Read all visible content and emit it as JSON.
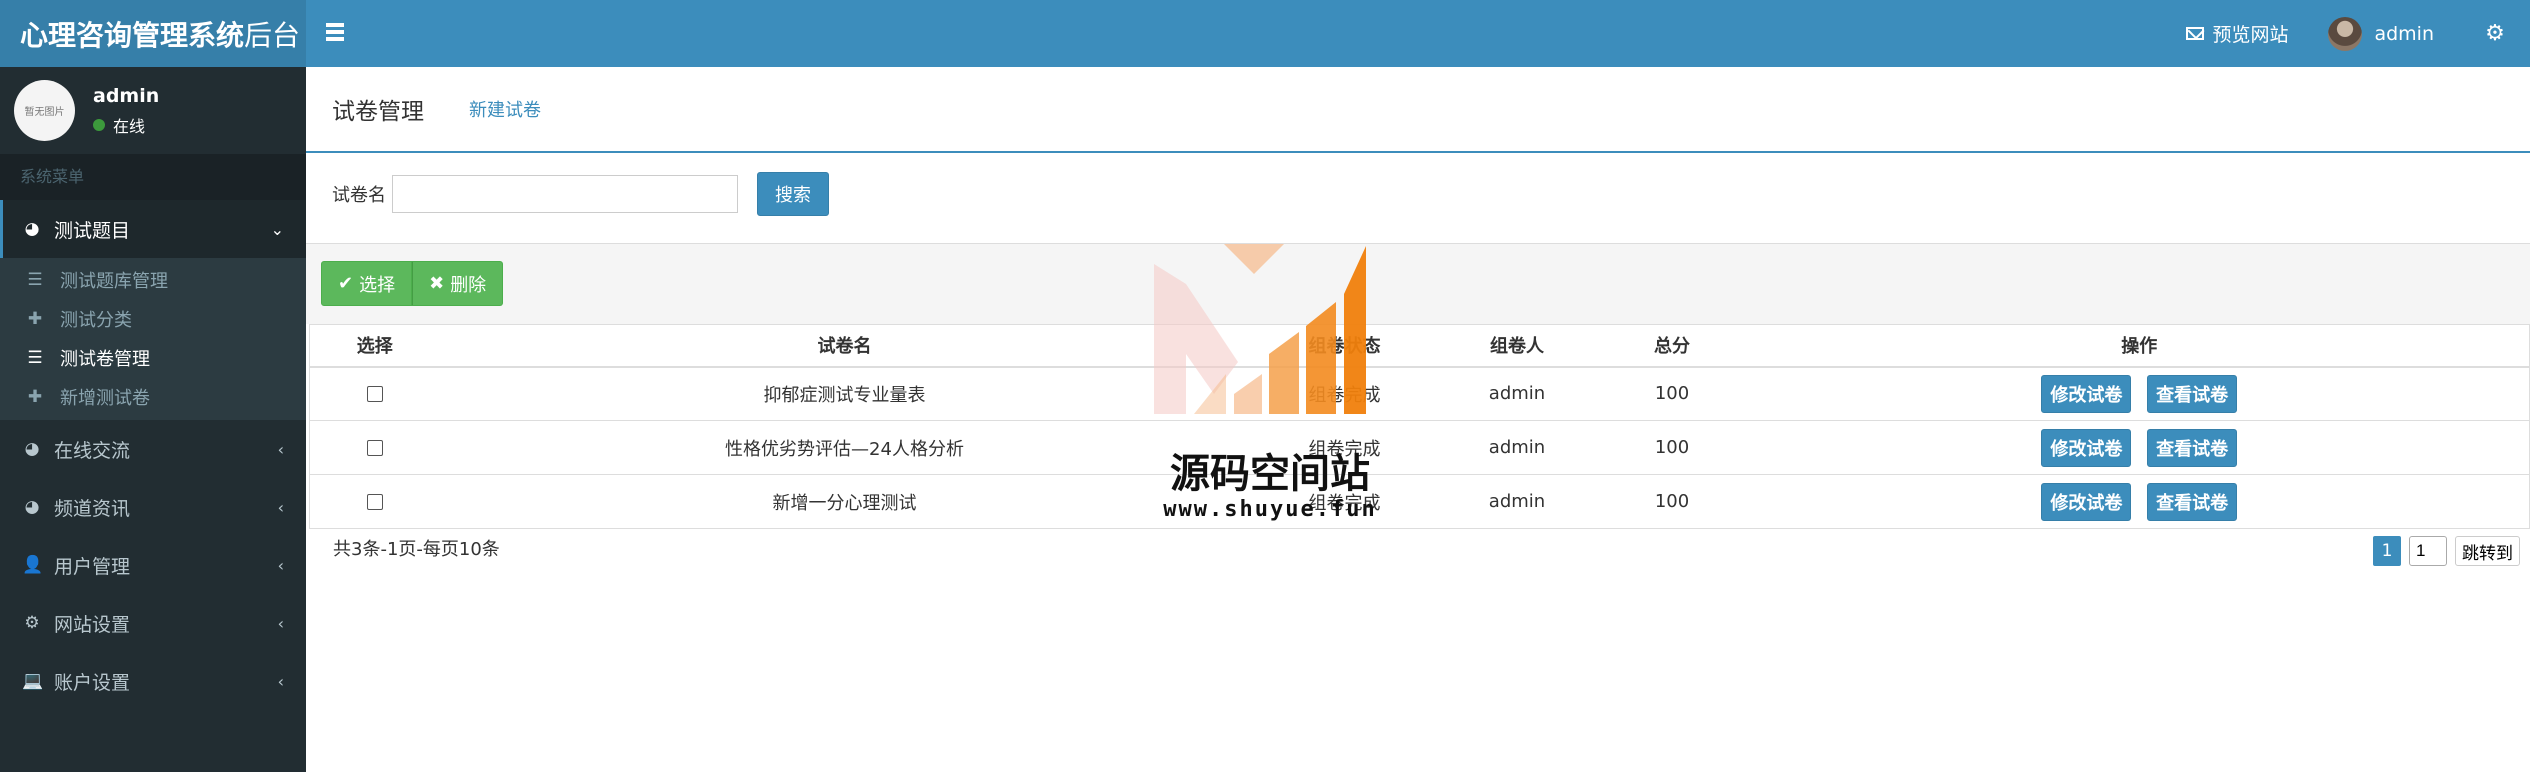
{
  "app": {
    "title_bold": "心理咨询管理系统",
    "title_light": "后台"
  },
  "topbar": {
    "preview_label": "预览网站",
    "username": "admin"
  },
  "sidebar": {
    "user": {
      "avatar_text": "暂无图片",
      "name": "admin",
      "status": "在线"
    },
    "menu_header": "系统菜单",
    "menu": [
      {
        "label": "测试题目",
        "icon": "pie-chart-icon",
        "expanded": true,
        "children": [
          {
            "label": "测试题库管理",
            "icon": "list-icon"
          },
          {
            "label": "测试分类",
            "icon": "plus-icon"
          },
          {
            "label": "测试卷管理",
            "icon": "list-icon",
            "active": true
          },
          {
            "label": "新增测试卷",
            "icon": "plus-icon"
          }
        ]
      },
      {
        "label": "在线交流",
        "icon": "pie-chart-icon"
      },
      {
        "label": "频道资讯",
        "icon": "pie-chart-icon"
      },
      {
        "label": "用户管理",
        "icon": "user-icon"
      },
      {
        "label": "网站设置",
        "icon": "gear-icon"
      },
      {
        "label": "账户设置",
        "icon": "laptop-icon"
      }
    ]
  },
  "content": {
    "title": "试卷管理",
    "new_link": "新建试卷",
    "search": {
      "label": "试卷名",
      "value": "",
      "button": "搜索"
    },
    "toolbar": {
      "select_label": "选择",
      "delete_label": "删除"
    },
    "table": {
      "headers": [
        "选择",
        "试卷名",
        "组卷状态",
        "组卷人",
        "总分",
        "操作"
      ],
      "rows": [
        {
          "name": "抑郁症测试专业量表",
          "status": "组卷完成",
          "creator": "admin",
          "score": "100"
        },
        {
          "name": "性格优劣势评估—24人格分析",
          "status": "组卷完成",
          "creator": "admin",
          "score": "100"
        },
        {
          "name": "新增一分心理测试",
          "status": "组卷完成",
          "creator": "admin",
          "score": "100"
        }
      ],
      "edit_label": "修改试卷",
      "view_label": "查看试卷"
    },
    "footer": "共3条-1页-每页10条",
    "pager": {
      "current": "1",
      "input": "1",
      "jump": "跳转到"
    }
  },
  "watermark": {
    "text": "源码空间站",
    "url": "www.shuyue.fun"
  },
  "colors": {
    "header": "#3c8dbc",
    "logo": "#367fa9",
    "sidebar": "#222d32",
    "success": "#5cb85c"
  }
}
